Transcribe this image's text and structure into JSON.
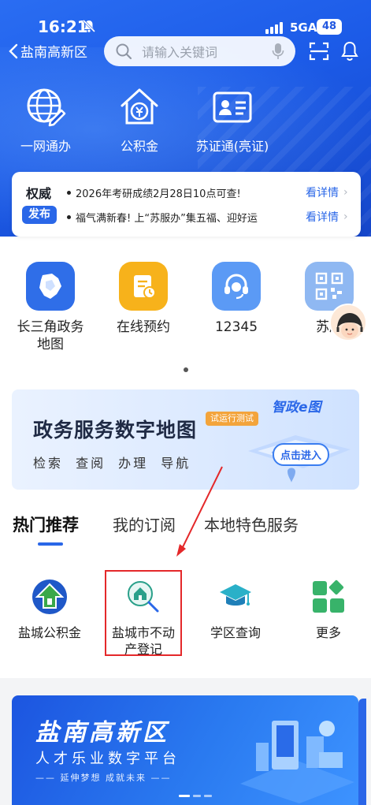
{
  "status": {
    "time": "16:21",
    "network": "5GA",
    "battery": "48"
  },
  "nav": {
    "back_label": "盐南高新区",
    "search_placeholder": "请输入关键词"
  },
  "quick_actions": [
    {
      "label": "一网通办",
      "icon": "globe-pen-icon"
    },
    {
      "label": "公积金",
      "icon": "house-yuan-icon"
    },
    {
      "label": "苏证通(亮证)",
      "icon": "id-card-icon"
    }
  ],
  "notice": {
    "title_top": "权威",
    "title_badge": "发布",
    "items": [
      {
        "text": "2026年考研成绩2月28日10点可查!",
        "more": "看详情"
      },
      {
        "text": "福气满新春! 上“苏服办”集五福、迎好运",
        "more": "看详情"
      }
    ]
  },
  "apps": [
    {
      "label": "长三角政务地图",
      "color": "#2f6ee8"
    },
    {
      "label": "在线预约",
      "color": "#f7b21b"
    },
    {
      "label": "12345",
      "color": "#5b9af5"
    },
    {
      "label": "苏服",
      "color": "#8fb8f2"
    }
  ],
  "banner": {
    "title": "政务服务数字地图",
    "subtitle": "检索 查阅 办理 导航",
    "tag": "试运行测试",
    "logo": "智政e图",
    "enter": "点击进入"
  },
  "tabs": [
    "热门推荐",
    "我的订阅",
    "本地特色服务"
  ],
  "services": [
    {
      "label": "盐城公积金"
    },
    {
      "label": "盐城市不动产登记"
    },
    {
      "label": "学区查询"
    },
    {
      "label": "更多"
    }
  ],
  "promo": {
    "title": "盐南高新区",
    "subtitle": "人才乐业数字平台",
    "tagline": "—— 延伸梦想 成就未来 ——"
  },
  "colors": {
    "primary": "#2a67e8",
    "header": "#1c5be8",
    "highlight": "#e4282a"
  }
}
